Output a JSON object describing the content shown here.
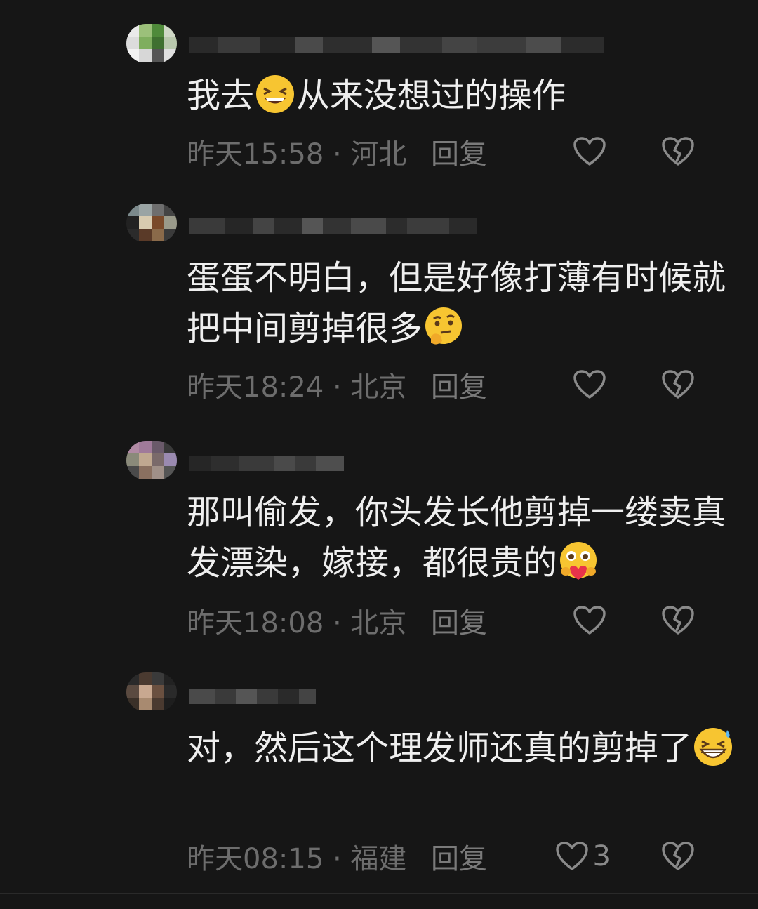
{
  "colors": {
    "background": "#161616",
    "text": "#efefef",
    "meta": "#6d6d6d"
  },
  "comments": [
    {
      "text_before": "我去",
      "emoji": "grinning-squint-face",
      "text_after": "从来没想过的操作",
      "time_location": "昨天15:58 · 河北",
      "reply_label": "回复",
      "like_count": ""
    },
    {
      "text_before": "蛋蛋不明白，但是好像打薄有时候就把中间剪掉很多",
      "emoji": "thinking-face",
      "text_after": "",
      "time_location": "昨天18:24 · 北京",
      "reply_label": "回复",
      "like_count": ""
    },
    {
      "text_before": "那叫偷发，你头发长他剪掉一缕卖真发漂染，嫁接，都很贵的",
      "emoji": "hugging-heart-face",
      "text_after": "",
      "time_location": "昨天18:08 · 北京",
      "reply_label": "回复",
      "like_count": ""
    },
    {
      "text_before": "对，然后这个理发师还真的剪掉了",
      "emoji": "grinning-sweat-face",
      "text_after": "",
      "time_location": "昨天08:15 · 福建",
      "reply_label": "回复",
      "like_count": "3"
    }
  ]
}
